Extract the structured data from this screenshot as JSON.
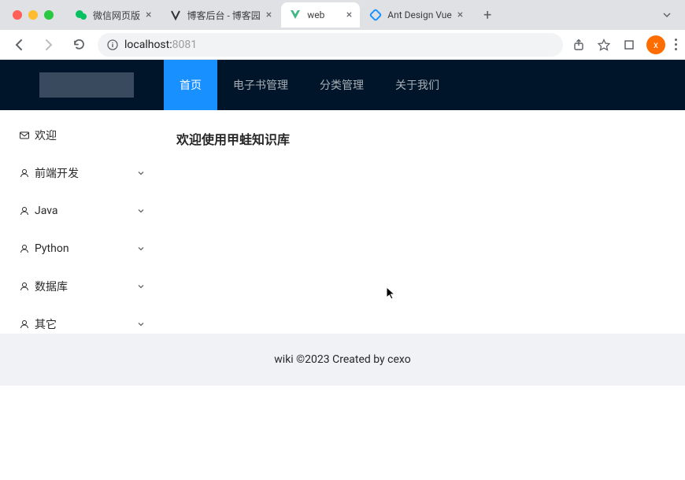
{
  "browser": {
    "tabs": [
      {
        "title": "微信网页版",
        "icon": "wechat"
      },
      {
        "title": "博客后台 - 博客园",
        "icon": "cnblogs"
      },
      {
        "title": "web",
        "icon": "vue",
        "active": true
      },
      {
        "title": "Ant Design Vue",
        "icon": "antd"
      }
    ],
    "url_host": "localhost:",
    "url_port": "8081",
    "avatar_initial": "x"
  },
  "nav": {
    "items": [
      {
        "label": "首页",
        "active": true
      },
      {
        "label": "电子书管理"
      },
      {
        "label": "分类管理"
      },
      {
        "label": "关于我们"
      }
    ]
  },
  "sidebar": {
    "items": [
      {
        "label": "欢迎",
        "icon": "mail",
        "expandable": false
      },
      {
        "label": "前端开发",
        "icon": "user",
        "expandable": true
      },
      {
        "label": "Java",
        "icon": "user",
        "expandable": true
      },
      {
        "label": "Python",
        "icon": "user",
        "expandable": true
      },
      {
        "label": "数据库",
        "icon": "user",
        "expandable": true
      },
      {
        "label": "其它",
        "icon": "user",
        "expandable": true
      }
    ]
  },
  "content": {
    "welcome_title": "欢迎使用甲蛙知识库"
  },
  "footer": {
    "text": "wiki ©2023 Created by cexo"
  }
}
